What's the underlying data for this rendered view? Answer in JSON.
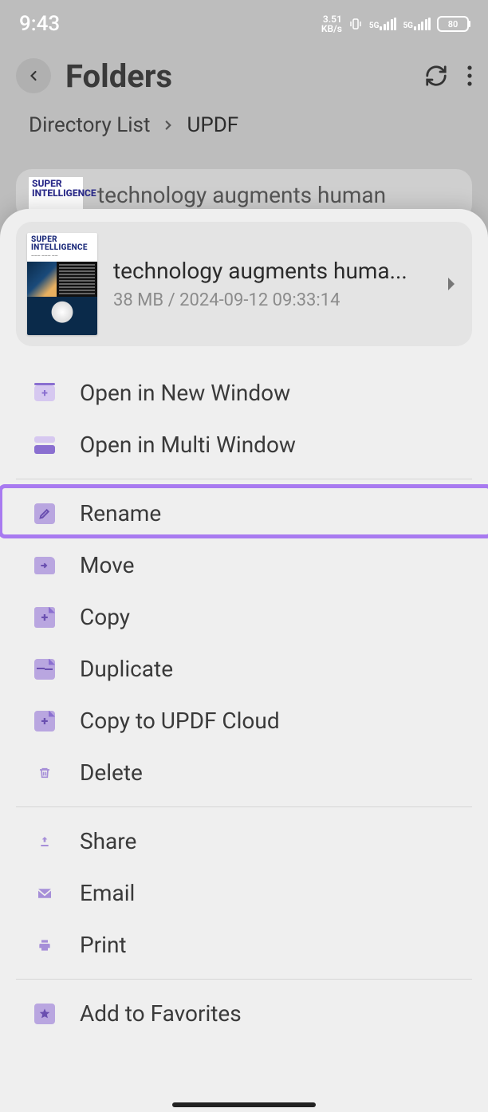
{
  "status": {
    "time": "9:43",
    "net_speed_top": "3.51",
    "net_speed_bot": "KB/s",
    "net1": "5G",
    "net2": "5G",
    "battery": "80"
  },
  "header": {
    "title": "Folders"
  },
  "breadcrumb": {
    "root": "Directory List",
    "current": "UPDF"
  },
  "bg_file": {
    "title": "technology augments human"
  },
  "file": {
    "name": "technology augments huma...",
    "size": "38 MB",
    "sep": " / ",
    "date": "2024-09-12 09:33:14",
    "thumb_title_line1": "SUPER",
    "thumb_title_line2": "INTELLIGENCE"
  },
  "menu": {
    "group1": [
      {
        "label": "Open in New Window"
      },
      {
        "label": "Open in Multi Window"
      }
    ],
    "group2": [
      {
        "label": "Rename"
      },
      {
        "label": "Move"
      },
      {
        "label": "Copy"
      },
      {
        "label": "Duplicate"
      },
      {
        "label": "Copy to UPDF Cloud"
      },
      {
        "label": "Delete"
      }
    ],
    "group3": [
      {
        "label": "Share"
      },
      {
        "label": "Email"
      },
      {
        "label": "Print"
      }
    ],
    "group4": [
      {
        "label": "Add to Favorites"
      }
    ]
  },
  "colors": {
    "accent": "#a87af0",
    "icon_fill": "#b9a6e0",
    "icon_dark": "#8a6fd0"
  }
}
